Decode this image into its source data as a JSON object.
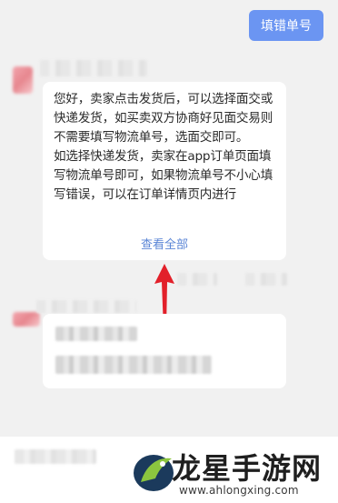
{
  "header": {
    "fill_tracking_button": "填错单号"
  },
  "message": {
    "paragraphs": [
      "您好，卖家点击发货后，可以选择面交或快递发货，如买卖双方协商好见面交易则不需要填写物流单号，选面交即可。",
      "如选择快递发货，卖家在app订单页面填写物流单号即可，如果物流单号不小心填写错误，可以在订单详情页内进行"
    ],
    "view_all": "查看全部"
  },
  "watermark": {
    "title": "龙星手游网",
    "url": "www.ahlongxing.com"
  },
  "colors": {
    "button_bg": "#6b95f2",
    "link": "#5b86d6",
    "arrow": "#e2202a"
  }
}
